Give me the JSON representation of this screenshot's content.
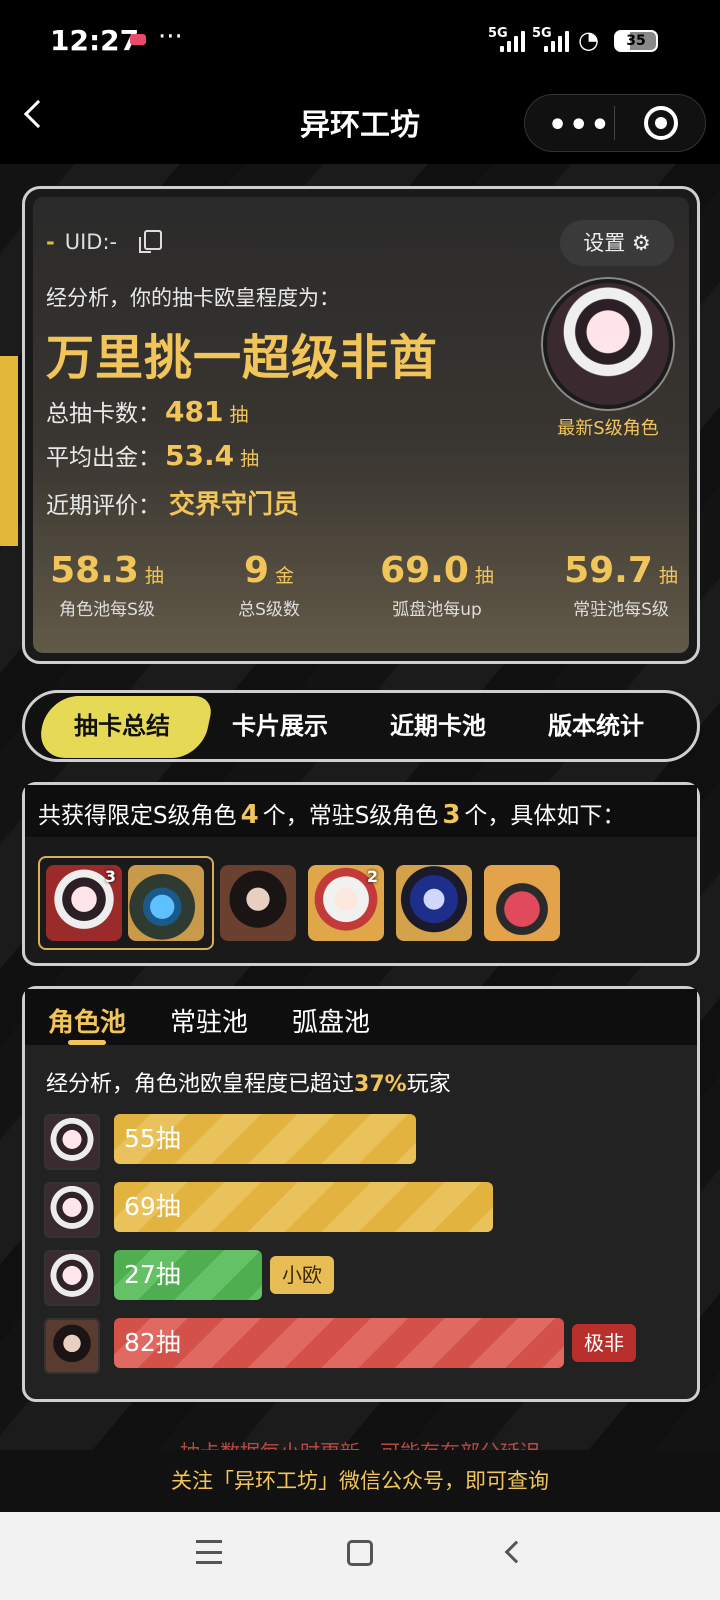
{
  "status": {
    "time": "12:27",
    "dots": "···",
    "net1": "5G",
    "net2": "5G",
    "battery": "35"
  },
  "nav": {
    "title": "异环工坊",
    "more": "•••"
  },
  "profile": {
    "uid_dash": "-",
    "uid": "UID:-",
    "settings": "设置 ⚙",
    "analysis": "经分析，你的抽卡欧皇程度为：",
    "rating": "万里挑一超级非酋",
    "total_label": "总抽卡数：",
    "total_value": "481",
    "unit_draw": "抽",
    "avg_label": "平均出金：",
    "avg_value": "53.4",
    "recent_label": "近期评价：",
    "recent_value": "交界守门员",
    "avatar_caption": "最新S级角色"
  },
  "stats": [
    {
      "n": "58.3",
      "u": "抽",
      "l": "角色池每S级"
    },
    {
      "n": "9",
      "u": "金",
      "l": "总S级数"
    },
    {
      "n": "69.0",
      "u": "抽",
      "l": "弧盘池每up"
    },
    {
      "n": "59.7",
      "u": "抽",
      "l": "常驻池每S级"
    }
  ],
  "tabs": [
    "抽卡总结",
    "卡片展示",
    "近期卡池",
    "版本统计"
  ],
  "summary": {
    "t1": "共获得限定S级角色",
    "n1": "4",
    "t2": "个，常驻S级角色",
    "n2": "3",
    "t3": "个，具体如下：",
    "tiles": [
      {
        "ct": "3"
      },
      {
        "ct": ""
      },
      {
        "ct": ""
      },
      {
        "ct": "2"
      },
      {
        "ct": ""
      },
      {
        "ct": ""
      }
    ]
  },
  "pool": {
    "tabs": [
      "角色池",
      "常驻池",
      "弧盘池"
    ],
    "t1": "经分析，角色池欧皇程度已超过",
    "pct": "37%",
    "t2": "玩家",
    "rows": [
      {
        "label": "55抽",
        "value": 55,
        "badge": ""
      },
      {
        "label": "69抽",
        "value": 69,
        "badge": ""
      },
      {
        "label": "27抽",
        "value": 27,
        "badge": "小欧"
      },
      {
        "label": "82抽",
        "value": 82,
        "badge": "极非"
      }
    ]
  },
  "notice": "抽卡数据每小时更新，可能存在部分延迟",
  "footer": "关注「异环工坊」微信公众号，即可查询"
}
